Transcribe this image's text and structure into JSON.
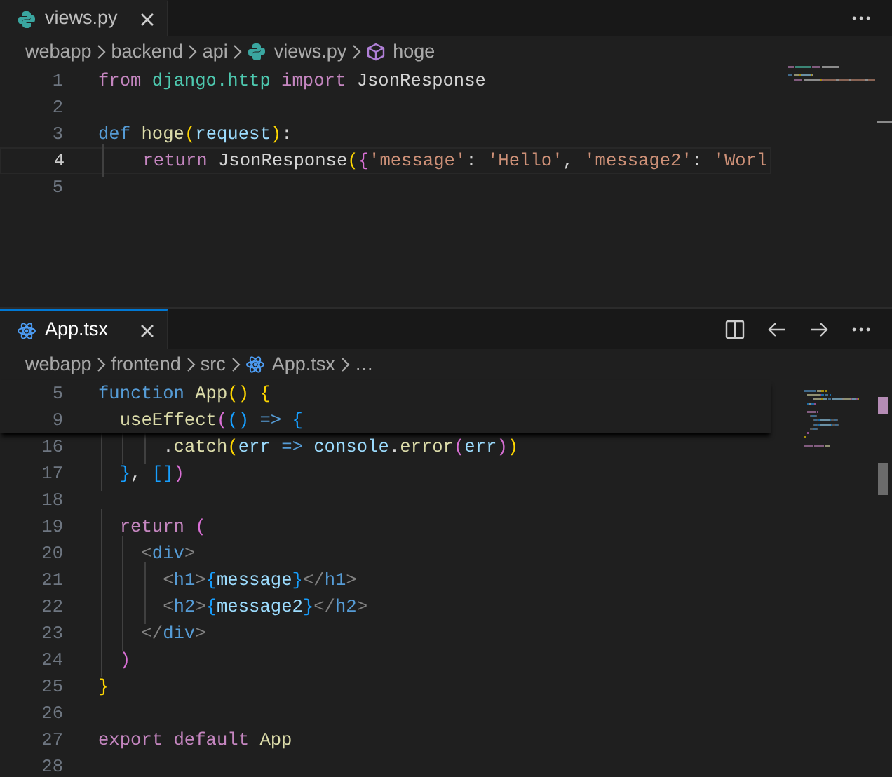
{
  "panes": [
    {
      "focused": false,
      "tab": {
        "label": "views.py",
        "kind": "python"
      },
      "actions": [
        {
          "kind": "more"
        }
      ],
      "breadcrumb": [
        {
          "label": "webapp",
          "kind": "folder"
        },
        {
          "label": "backend",
          "kind": "folder"
        },
        {
          "label": "api",
          "kind": "folder"
        },
        {
          "label": "views.py",
          "kind": "python"
        },
        {
          "label": "hoge",
          "kind": "symbol"
        }
      ],
      "lines": [
        {
          "number": "1",
          "current": false,
          "tokens": [
            {
              "kind": "kw",
              "text": "from"
            },
            {
              "kind": "type",
              "text": " django.http"
            },
            {
              "kind": "kw",
              "text": " import"
            },
            {
              "kind": "plain",
              "text": " JsonResponse"
            }
          ]
        },
        {
          "number": "2",
          "current": false
        },
        {
          "number": "3",
          "current": false,
          "tokens": [
            {
              "kind": "storage",
              "text": "def"
            },
            {
              "kind": "fn",
              "text": " hoge"
            },
            {
              "kind": "b1",
              "text": "("
            },
            {
              "kind": "var",
              "text": "request"
            },
            {
              "kind": "b1",
              "text": ")"
            },
            {
              "kind": "plain",
              "text": ":"
            }
          ]
        },
        {
          "number": "4",
          "current": true,
          "tokens": [
            {
              "kind": "kw",
              "text": "    return"
            },
            {
              "kind": "plain",
              "text": " JsonResponse"
            },
            {
              "kind": "b1",
              "text": "("
            },
            {
              "kind": "b2",
              "text": "{"
            },
            {
              "kind": "str",
              "text": "'message'"
            },
            {
              "kind": "plain",
              "text": ": "
            },
            {
              "kind": "str",
              "text": "'Hello'"
            },
            {
              "kind": "plain",
              "text": ", "
            },
            {
              "kind": "str",
              "text": "'message2'"
            },
            {
              "kind": "plain",
              "text": ": "
            },
            {
              "kind": "str",
              "text": "'Worl"
            }
          ]
        },
        {
          "number": "5",
          "current": false
        }
      ]
    },
    {
      "focused": true,
      "tab": {
        "label": "App.tsx",
        "kind": "react"
      },
      "actions": [
        {
          "kind": "split"
        },
        {
          "kind": "back"
        },
        {
          "kind": "forward"
        },
        {
          "kind": "more"
        }
      ],
      "breadcrumb": [
        {
          "label": "webapp",
          "kind": "folder"
        },
        {
          "label": "frontend",
          "kind": "folder"
        },
        {
          "label": "src",
          "kind": "folder"
        },
        {
          "label": "App.tsx",
          "kind": "react"
        },
        {
          "label": "…",
          "kind": "folder"
        }
      ],
      "sticky_lines": [
        {
          "number": "5",
          "tokens": [
            {
              "kind": "storage",
              "text": "function"
            },
            {
              "kind": "fn",
              "text": " App"
            },
            {
              "kind": "b1",
              "text": "()"
            },
            {
              "kind": "b1",
              "text": " {"
            }
          ]
        },
        {
          "number": "9",
          "tokens": [
            {
              "kind": "fn",
              "text": "  useEffect"
            },
            {
              "kind": "b2",
              "text": "("
            },
            {
              "kind": "b3",
              "text": "()"
            },
            {
              "kind": "storage",
              "text": " =>"
            },
            {
              "kind": "b3",
              "text": " {"
            }
          ]
        }
      ],
      "lines": [
        {
          "number": "16",
          "current": false,
          "tokens": [
            {
              "kind": "plain",
              "text": "      ."
            },
            {
              "kind": "fn",
              "text": "catch"
            },
            {
              "kind": "b1",
              "text": "("
            },
            {
              "kind": "var",
              "text": "err"
            },
            {
              "kind": "storage",
              "text": " =>"
            },
            {
              "kind": "var",
              "text": " console"
            },
            {
              "kind": "plain",
              "text": "."
            },
            {
              "kind": "fn",
              "text": "error"
            },
            {
              "kind": "b2",
              "text": "("
            },
            {
              "kind": "var",
              "text": "err"
            },
            {
              "kind": "b2",
              "text": ")"
            },
            {
              "kind": "b1",
              "text": ")"
            }
          ]
        },
        {
          "number": "17",
          "current": false,
          "tokens": [
            {
              "kind": "b3",
              "text": "  }"
            },
            {
              "kind": "plain",
              "text": ", "
            },
            {
              "kind": "b3",
              "text": "[]"
            },
            {
              "kind": "b2",
              "text": ")"
            }
          ]
        },
        {
          "number": "18",
          "current": false
        },
        {
          "number": "19",
          "current": false,
          "tokens": [
            {
              "kind": "kw",
              "text": "  return"
            },
            {
              "kind": "b2",
              "text": " ("
            }
          ]
        },
        {
          "number": "20",
          "current": false,
          "tokens": [
            {
              "kind": "punct",
              "text": "    <"
            },
            {
              "kind": "tag",
              "text": "div"
            },
            {
              "kind": "punct",
              "text": ">"
            }
          ]
        },
        {
          "number": "21",
          "current": false,
          "tokens": [
            {
              "kind": "punct",
              "text": "      <"
            },
            {
              "kind": "tag",
              "text": "h1"
            },
            {
              "kind": "punct",
              "text": ">"
            },
            {
              "kind": "b3",
              "text": "{"
            },
            {
              "kind": "var",
              "text": "message"
            },
            {
              "kind": "b3",
              "text": "}"
            },
            {
              "kind": "punct",
              "text": "</"
            },
            {
              "kind": "tag",
              "text": "h1"
            },
            {
              "kind": "punct",
              "text": ">"
            }
          ]
        },
        {
          "number": "22",
          "current": false,
          "tokens": [
            {
              "kind": "punct",
              "text": "      <"
            },
            {
              "kind": "tag",
              "text": "h2"
            },
            {
              "kind": "punct",
              "text": ">"
            },
            {
              "kind": "b3",
              "text": "{"
            },
            {
              "kind": "var",
              "text": "message2"
            },
            {
              "kind": "b3",
              "text": "}"
            },
            {
              "kind": "punct",
              "text": "</"
            },
            {
              "kind": "tag",
              "text": "h2"
            },
            {
              "kind": "punct",
              "text": ">"
            }
          ]
        },
        {
          "number": "23",
          "current": false,
          "tokens": [
            {
              "kind": "punct",
              "text": "    </"
            },
            {
              "kind": "tag",
              "text": "div"
            },
            {
              "kind": "punct",
              "text": ">"
            }
          ]
        },
        {
          "number": "24",
          "current": false,
          "tokens": [
            {
              "kind": "b2",
              "text": "  )"
            }
          ]
        },
        {
          "number": "25",
          "current": false,
          "tokens": [
            {
              "kind": "b1",
              "text": "}"
            }
          ]
        },
        {
          "number": "26",
          "current": false
        },
        {
          "number": "27",
          "current": false,
          "tokens": [
            {
              "kind": "kw",
              "text": "export"
            },
            {
              "kind": "kw",
              "text": " default"
            },
            {
              "kind": "fn",
              "text": " App"
            }
          ]
        },
        {
          "number": "28",
          "current": false
        }
      ]
    }
  ]
}
